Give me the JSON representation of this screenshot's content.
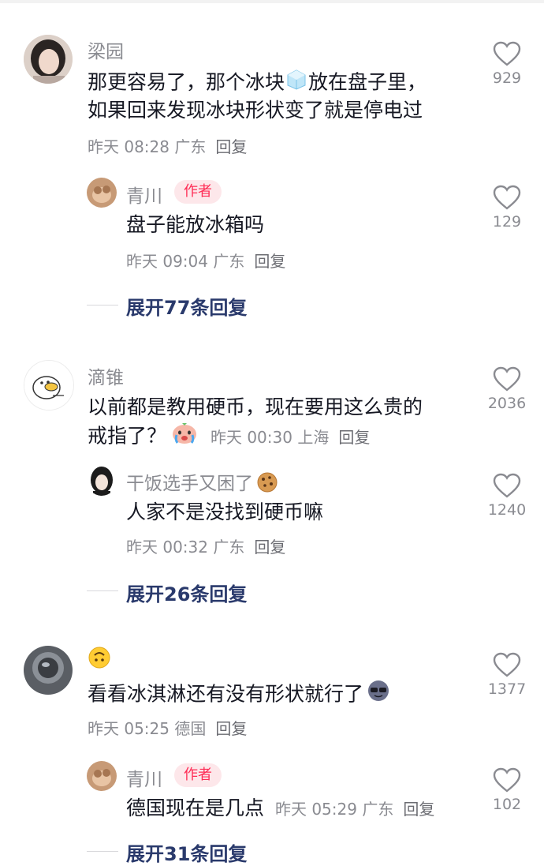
{
  "comments": [
    {
      "name": "梁园",
      "text_a": "那更容易了，那个冰块",
      "text_b": "放在盘子里，",
      "text_line2": "如果回来发现冰块形状变了就是停电过",
      "time": "昨天 08:28",
      "location": "广东",
      "reply": "回复",
      "likes": "929",
      "emoji": "ice-cube"
    },
    {
      "name": "青川",
      "tag": "作者",
      "text": "盘子能放冰箱吗",
      "time": "昨天 09:04",
      "location": "广东",
      "reply": "回复",
      "likes": "129",
      "expand": "展开77条回复"
    },
    {
      "name": "滴锥",
      "text_line1": "以前都是教用硬币，现在要用这么贵的",
      "text_line2": "戒指了？",
      "time": "昨天 00:30",
      "location": "上海",
      "reply": "回复",
      "likes": "2036",
      "emoji": "crying-face"
    },
    {
      "name": "干饭选手又困了",
      "text": "人家不是没找到硬币嘛",
      "time": "昨天 00:32",
      "location": "广东",
      "reply": "回复",
      "likes": "1240",
      "expand": "展开26条回复",
      "emoji": "cookie"
    },
    {
      "text": "看看冰淇淋还有没有形状就行了",
      "time": "昨天 05:25",
      "location": "德国",
      "reply": "回复",
      "likes": "1377",
      "emoji_name": "upside-down-face",
      "emoji_end": "cool-face"
    },
    {
      "name": "青川",
      "tag": "作者",
      "text": "德国现在是几点",
      "time": "昨天 05:29",
      "location": "广东",
      "reply": "回复",
      "likes": "102",
      "expand": "展开31条回复"
    }
  ]
}
